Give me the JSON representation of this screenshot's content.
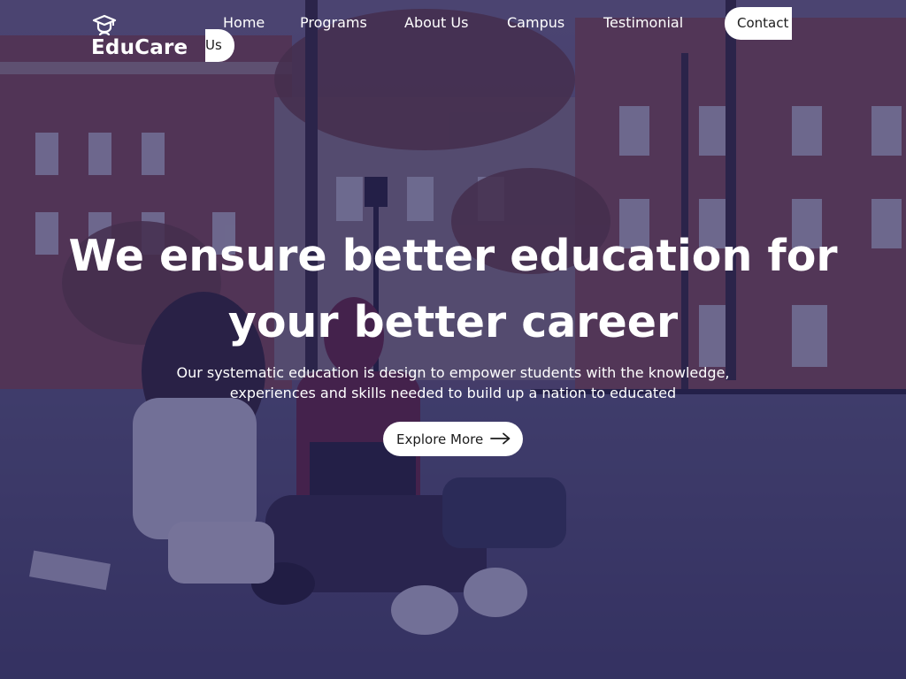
{
  "brand": {
    "name": "EduCare",
    "logo_icon": "graduation-cap-icon"
  },
  "nav": {
    "links": [
      {
        "label": "Home"
      },
      {
        "label": "Programs"
      },
      {
        "label": "About Us"
      },
      {
        "label": "Campus"
      },
      {
        "label": "Testimonial"
      }
    ],
    "contact_label_line1": "Contact",
    "contact_label_line2": "Us"
  },
  "hero": {
    "headline_line1": "We ensure better education for",
    "headline_line2": "your better career",
    "subtext_line1": "Our systematic education is design to empower students with the knowledge,",
    "subtext_line2": "experiences and skills needed to build up a nation to educated",
    "cta_label": "Explore More",
    "cta_icon": "arrow-right-icon"
  },
  "colors": {
    "overlay": "#1e1a58",
    "text": "#ffffff",
    "button_bg": "#ffffff",
    "button_text": "#1c1c1c"
  }
}
